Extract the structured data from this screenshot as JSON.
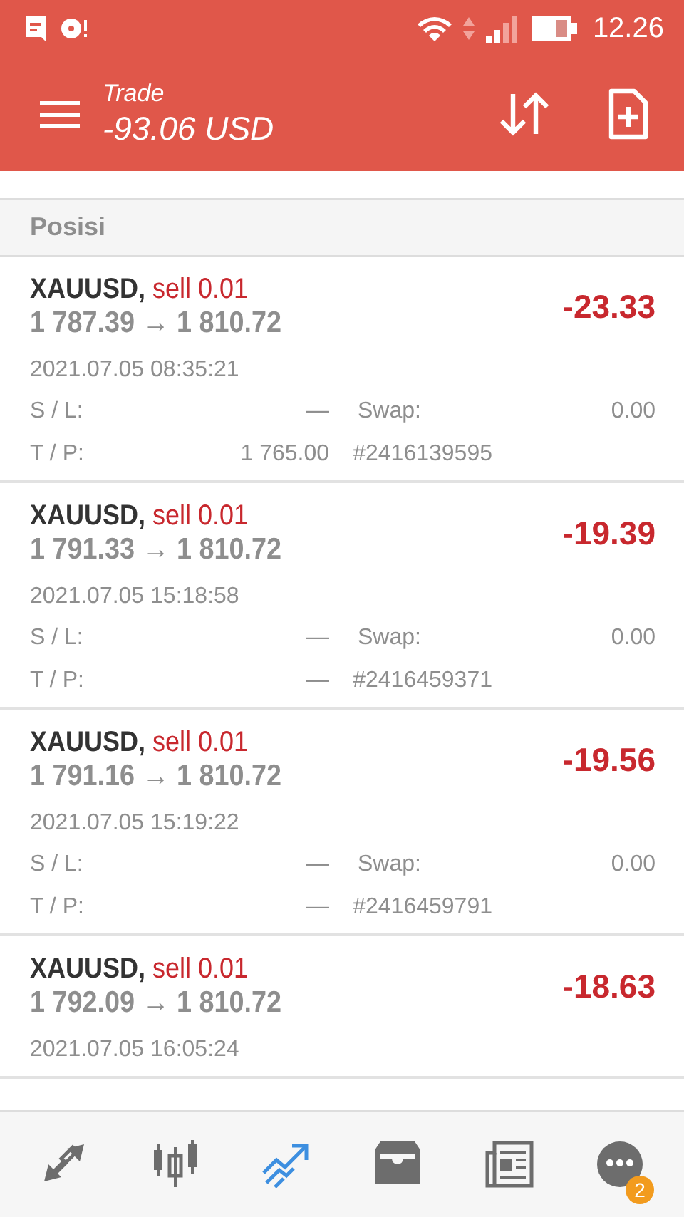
{
  "status_bar": {
    "time": "12.26"
  },
  "toolbar": {
    "title": "Trade",
    "subtitle": "-93.06 USD"
  },
  "section": {
    "title": "Posisi"
  },
  "positions": [
    {
      "symbol": "XAUUSD,",
      "side": "sell 0.01",
      "prices": "1 787.39 → 1 810.72",
      "profit": "-23.33",
      "time": "2021.07.05 08:35:21",
      "sl_label": "S / L:",
      "sl": "—",
      "swap_label": "Swap:",
      "swap": "0.00",
      "tp_label": "T / P:",
      "tp": "1 765.00",
      "ticket": "#2416139595"
    },
    {
      "symbol": "XAUUSD,",
      "side": "sell 0.01",
      "prices": "1 791.33 → 1 810.72",
      "profit": "-19.39",
      "time": "2021.07.05 15:18:58",
      "sl_label": "S / L:",
      "sl": "—",
      "swap_label": "Swap:",
      "swap": "0.00",
      "tp_label": "T / P:",
      "tp": "—",
      "ticket": "#2416459371"
    },
    {
      "symbol": "XAUUSD,",
      "side": "sell 0.01",
      "prices": "1 791.16 → 1 810.72",
      "profit": "-19.56",
      "time": "2021.07.05 15:19:22",
      "sl_label": "S / L:",
      "sl": "—",
      "swap_label": "Swap:",
      "swap": "0.00",
      "tp_label": "T / P:",
      "tp": "—",
      "ticket": "#2416459791"
    },
    {
      "symbol": "XAUUSD,",
      "side": "sell 0.01",
      "prices": "1 792.09 → 1 810.72",
      "profit": "-18.63",
      "time": "2021.07.05 16:05:24"
    }
  ],
  "nav": [
    {
      "kind": "quotes",
      "selected": false
    },
    {
      "kind": "chart",
      "selected": false
    },
    {
      "kind": "trade",
      "selected": true
    },
    {
      "kind": "history",
      "selected": false
    },
    {
      "kind": "news",
      "selected": false
    },
    {
      "kind": "chat",
      "selected": false,
      "badge": "2"
    }
  ]
}
